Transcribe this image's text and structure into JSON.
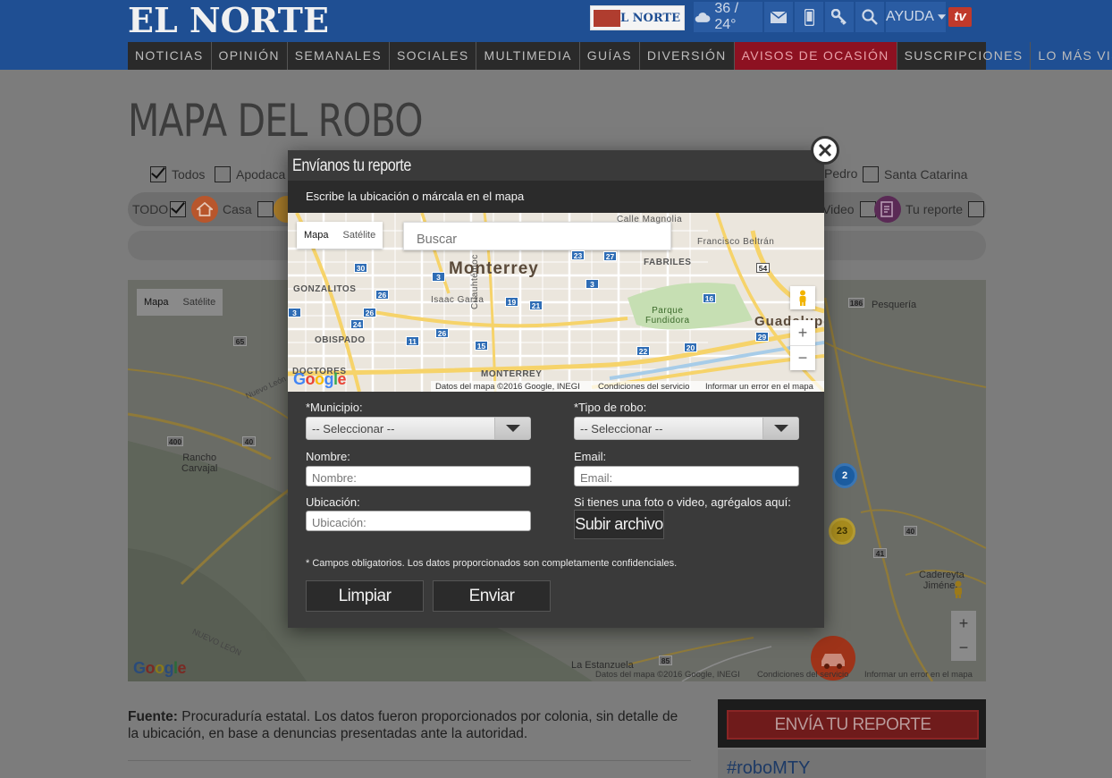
{
  "header": {
    "logo": "EL NORTE",
    "paper_logo": "EL NORTE",
    "weather": "36 / 24°",
    "help_label": "AYUDA",
    "tv_label": "tv"
  },
  "nav": [
    {
      "label": "NOTICIAS"
    },
    {
      "label": "OPINIÓN"
    },
    {
      "label": "SEMANALES"
    },
    {
      "label": "SOCIALES"
    },
    {
      "label": "MULTIMEDIA"
    },
    {
      "label": "GUÍAS"
    },
    {
      "label": "DIVERSIÓN"
    },
    {
      "label": "AVISOS DE OCASIÓN",
      "active": true
    },
    {
      "label": "SUSCRIPCIONES"
    },
    {
      "label": "LO MÁS VISTO"
    }
  ],
  "page": {
    "title": "MAPA DEL ROBO",
    "municipios": {
      "todos": "Todos",
      "apodaca": "Apodaca",
      "san_pedro_partial": "Pedro",
      "santa_catarina": "Santa Catarina"
    },
    "categories": {
      "todo": "TODO",
      "casa": "Casa",
      "video_partial": "Video",
      "tu_reporte": "Tu reporte"
    }
  },
  "bg_map": {
    "maptype_map": "Mapa",
    "maptype_sat": "Satélite",
    "places": {
      "rancho": "Rancho\nCarvajal",
      "pesqueria": "Pesquería",
      "cadereyta": "Cadereyta\nJiménez",
      "la_estanzuela": "La Estanzuela",
      "nuevo_leon": "NUEVO LEÓN",
      "nuevo_leon2": "Nuevo León"
    },
    "clusters": [
      "2",
      "23"
    ],
    "shields": [
      "65",
      "400",
      "40",
      "186",
      "40",
      "41",
      "85"
    ],
    "attribution": "Datos del mapa ©2016 Google, INEGI",
    "terms": "Condiciones del servicio",
    "report_error": "Informar un error en el mapa",
    "zoom_in": "+",
    "zoom_out": "−"
  },
  "source": {
    "label": "Fuente:",
    "text": "Procuraduría estatal. Los datos fueron proporcionados por colonia, sin detalle de la ubicación, en base a denuncias presentadas ante la autoridad."
  },
  "sidebar": {
    "report_button": "ENVÍA TU REPORTE",
    "hashtag": "#roboMTY"
  },
  "modal": {
    "title": "Envíanos tu reporte",
    "instruction": "Escribe la ubicación o márcala en el mapa",
    "map": {
      "maptype_map": "Mapa",
      "maptype_sat": "Satélite",
      "search_placeholder": "Buscar",
      "city": "Monterrey",
      "guadalupe": "Guadalupe",
      "labels": [
        "Calle Magnolia",
        "Francisco Beltrán",
        "FABRILES",
        "GONZALITOS",
        "Isaac Garza",
        "Cuauhtémoc",
        "Parque\nFundidora",
        "OBISPADO",
        "DOCTORES",
        "MONTERREY"
      ],
      "shields": [
        "30",
        "3",
        "23",
        "27",
        "26",
        "19",
        "21",
        "3",
        "26",
        "24",
        "11",
        "26",
        "15",
        "54",
        "16",
        "22",
        "20",
        "29",
        "3"
      ],
      "attribution": "Datos del mapa ©2016 Google, INEGI",
      "terms": "Condiciones del servicio",
      "report_error": "Informar un error en el mapa",
      "zoom_in": "+",
      "zoom_out": "−"
    },
    "form": {
      "municipio_label": "*Municipio:",
      "municipio_value": "-- Seleccionar --",
      "tipo_label": "*Tipo de robo:",
      "tipo_value": "-- Seleccionar --",
      "nombre_label": "Nombre:",
      "nombre_placeholder": "Nombre:",
      "email_label": "Email:",
      "email_placeholder": "Email:",
      "ubicacion_label": "Ubicación:",
      "ubicacion_placeholder": "Ubicación:",
      "upload_label": "Si tienes una foto o video, agrégalos aquí:",
      "upload_button": "Subir archivo",
      "note": "* Campos obligatorios. Los datos proporcionados son completamente confidenciales.",
      "clear_button": "Limpiar",
      "submit_button": "Enviar"
    }
  },
  "colors": {
    "header_blue": "#1f4f93",
    "nav_active": "#8d1121",
    "modal_bg": "#3a3a3a",
    "report_red": "#6f1b1b"
  }
}
